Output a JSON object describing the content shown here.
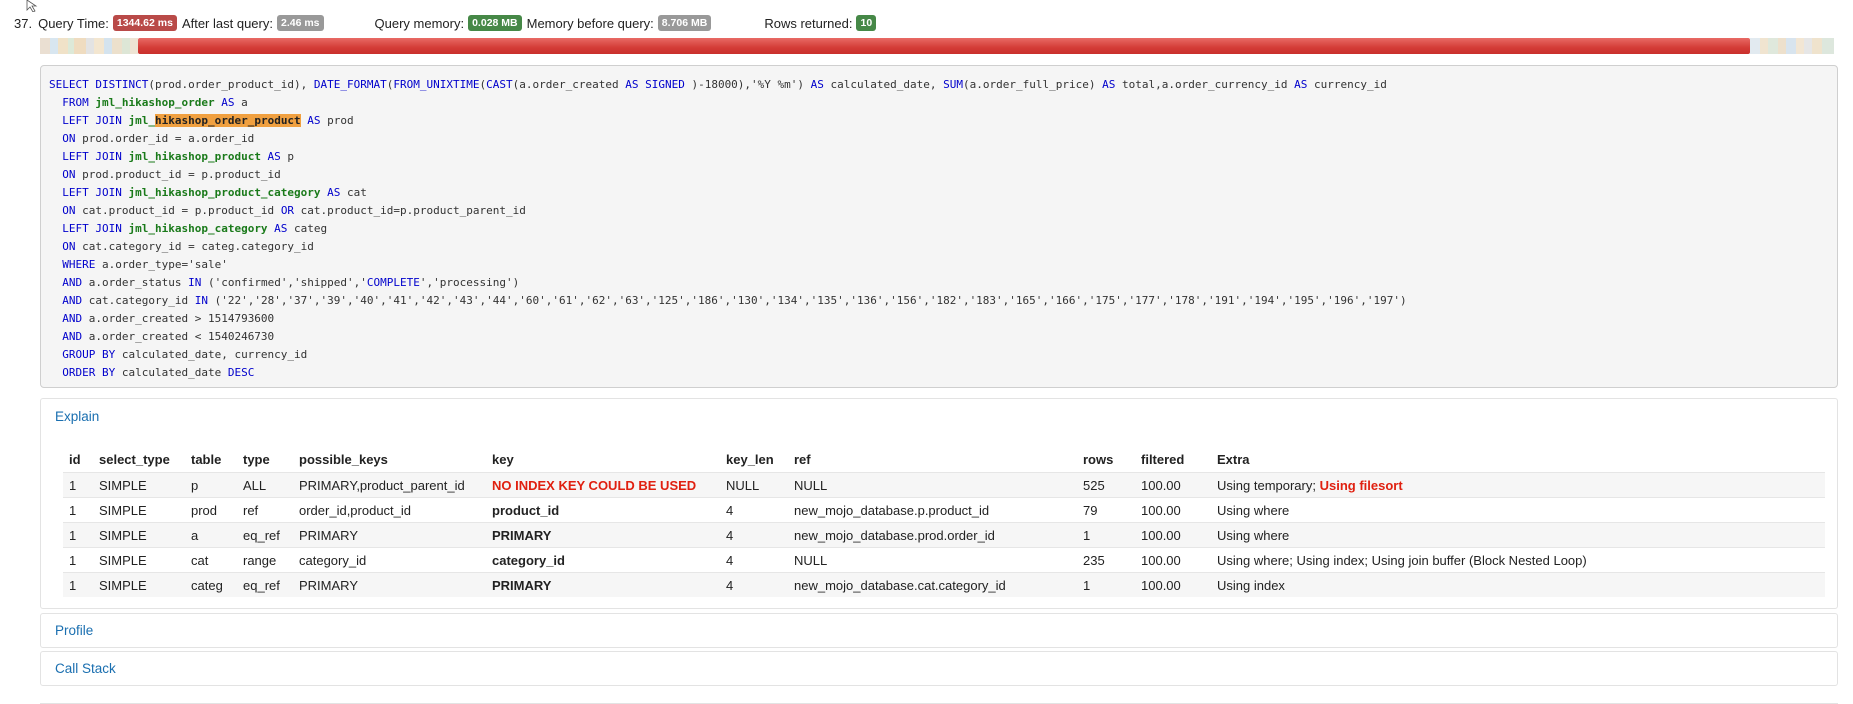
{
  "query": {
    "number": "37.",
    "query_time_label": "Query Time:",
    "query_time_value": "1344.62 ms",
    "after_last_label": "After last query:",
    "after_last_value": "2.46 ms",
    "memory_label": "Query memory:",
    "memory_value": "0.028 MB",
    "memory_before_label": "Memory before query:",
    "memory_before_value": "8.706 MB",
    "rows_label": "Rows returned:",
    "rows_value": "10"
  },
  "colors": {
    "badge_red": "#b94a48",
    "badge_gray": "#999999",
    "badge_green": "#468847",
    "timeline_main": "#d43c37",
    "link_blue": "#1a6fb0",
    "warning_red": "#e02010",
    "highlight_orange": "#f0a040"
  },
  "sql": {
    "line1_a": "SELECT DISTINCT",
    "line1_b": "(prod.order_product_id), ",
    "line1_c": "DATE_FORMAT",
    "line1_d": "(",
    "line1_e": "FROM_UNIXTIME",
    "line1_f": "(",
    "line1_g": "CAST",
    "line1_h": "(a.order_created ",
    "line1_i": "AS SIGNED",
    "line1_j": " )-18000),'%Y %m') ",
    "line1_k": "AS",
    "line1_l": " calculated_date, ",
    "line1_m": "SUM",
    "line1_n": "(a.order_full_price) ",
    "line1_o": "AS",
    "line1_p": " total,a.order_currency_id ",
    "line1_q": "AS",
    "line1_r": " currency_id",
    "line2_kw": "  FROM ",
    "line2_tbl": "jml_hikashop_order",
    "line2_kw2": " AS",
    "line2_rest": " a",
    "line3_kw": "  LEFT JOIN ",
    "line3_tbl": "jml_",
    "line3_hl": "hikashop_order_product",
    "line3_kw2": " AS",
    "line3_rest": " prod",
    "line4_kw": "  ON",
    "line4_rest": " prod.order_id = a.order_id",
    "line5_kw": "  LEFT JOIN ",
    "line5_tbl": "jml_hikashop_product",
    "line5_kw2": " AS",
    "line5_rest": " p",
    "line6_kw": "  ON",
    "line6_rest": " prod.product_id = p.product_id",
    "line7_kw": "  LEFT JOIN ",
    "line7_tbl": "jml_hikashop_product_category",
    "line7_kw2": " AS",
    "line7_rest": " cat",
    "line8_kw": "  ON",
    "line8_rest1": " cat.product_id = p.product_id ",
    "line8_kw2": "OR",
    "line8_rest2": " cat.product_id=p.product_parent_id",
    "line9_kw": "  LEFT JOIN ",
    "line9_tbl": "jml_hikashop_category",
    "line9_kw2": " AS",
    "line9_rest": " categ",
    "line10_kw": "  ON",
    "line10_rest": " cat.category_id = categ.category_id",
    "line11_kw": "  WHERE",
    "line11_rest": " a.order_type='sale'",
    "line12_kw": "  AND",
    "line12_rest1": " a.order_status ",
    "line12_kw2": "IN",
    "line12_rest2": " ('confirmed','shipped','",
    "line12_kw3": "COMPLETE",
    "line12_rest3": "','processing')",
    "line13_kw": "  AND",
    "line13_rest1": " cat.category_id ",
    "line13_kw2": "IN",
    "line13_rest2": " ('22','28','37','39','40','41','42','43','44','60','61','62','63','125','186','130','134','135','136','156','182','183','165','166','175','177','178','191','194','195','196','197')",
    "line14_kw": "  AND",
    "line14_rest": " a.order_created > 1514793600",
    "line15_kw": "  AND",
    "line15_rest": " a.order_created < 1540246730",
    "line16_kw": "  GROUP BY",
    "line16_rest": " calculated_date, currency_id",
    "line17_kw": "  ORDER BY",
    "line17_rest": " calculated_date ",
    "line17_kw2": "DESC"
  },
  "explain": {
    "title": "Explain",
    "headers": [
      "id",
      "select_type",
      "table",
      "type",
      "possible_keys",
      "key",
      "key_len",
      "ref",
      "rows",
      "filtered",
      "Extra"
    ],
    "rows": [
      {
        "id": "1",
        "select_type": "SIMPLE",
        "table": "p",
        "type": "ALL",
        "possible_keys": "PRIMARY,product_parent_id",
        "key": "NO INDEX KEY COULD BE USED",
        "key_len": "NULL",
        "ref": "NULL",
        "rows": "525",
        "filtered": "100.00",
        "extra": "Using temporary; ",
        "extra_warn": "Using filesort"
      },
      {
        "id": "1",
        "select_type": "SIMPLE",
        "table": "prod",
        "type": "ref",
        "possible_keys": "order_id,product_id",
        "key": "product_id",
        "key_len": "4",
        "ref": "new_mojo_database.p.product_id",
        "rows": "79",
        "filtered": "100.00",
        "extra": "Using where",
        "extra_warn": ""
      },
      {
        "id": "1",
        "select_type": "SIMPLE",
        "table": "a",
        "type": "eq_ref",
        "possible_keys": "PRIMARY",
        "key": "PRIMARY",
        "key_len": "4",
        "ref": "new_mojo_database.prod.order_id",
        "rows": "1",
        "filtered": "100.00",
        "extra": "Using where",
        "extra_warn": ""
      },
      {
        "id": "1",
        "select_type": "SIMPLE",
        "table": "cat",
        "type": "range",
        "possible_keys": "category_id",
        "key": "category_id",
        "key_len": "4",
        "ref": "NULL",
        "rows": "235",
        "filtered": "100.00",
        "extra": "Using where; Using index; Using join buffer (Block Nested Loop)",
        "extra_warn": ""
      },
      {
        "id": "1",
        "select_type": "SIMPLE",
        "table": "categ",
        "type": "eq_ref",
        "possible_keys": "PRIMARY",
        "key": "PRIMARY",
        "key_len": "4",
        "ref": "new_mojo_database.cat.category_id",
        "rows": "1",
        "filtered": "100.00",
        "extra": "Using index",
        "extra_warn": ""
      }
    ]
  },
  "profile": {
    "title": "Profile"
  },
  "callstack": {
    "title": "Call Stack"
  },
  "icons": {
    "cursor": "mouse-pointer-icon"
  }
}
